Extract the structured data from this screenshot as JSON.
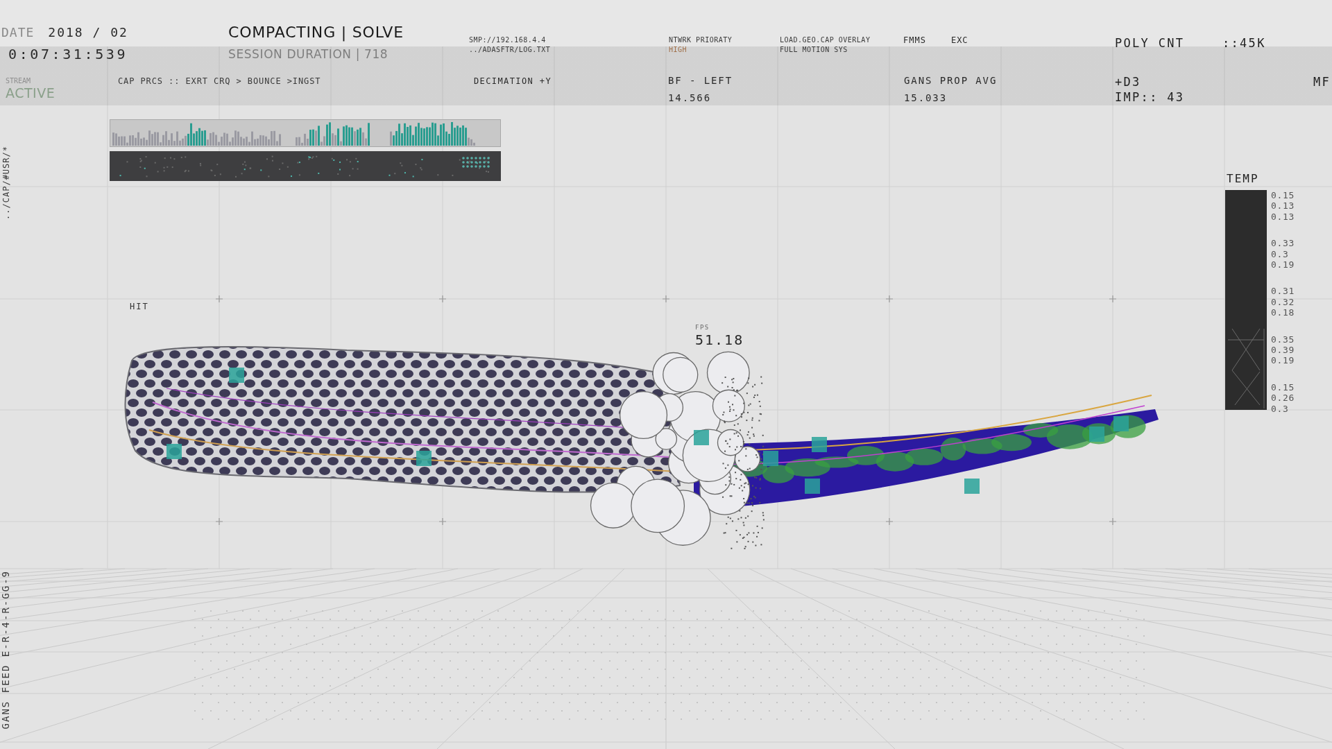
{
  "header": {
    "date_label": "DATE",
    "date": "2018 / 02",
    "clock": "0:07:31:539",
    "title": "COMPACTING | SOLVE",
    "session": "SESSION DURATION | 718",
    "stream_label": "STREAM",
    "stream_status": "ACTIVE",
    "pipeline": "CAP PRCS :: EXRT CRQ > BOUNCE >INGST",
    "path_lines": [
      "SMP://192.168.4.4",
      "../ADASFTR/LOG.TXT"
    ],
    "decimation": "DECIMATION +Y",
    "network": {
      "label": "NTWRK PRIORATY",
      "value": "HIGH"
    },
    "overlay_lines": [
      "LOAD.GEO.CAP OVERLAY",
      "FULL MOTION SYS"
    ],
    "flags": [
      "FMMS",
      "EXC"
    ],
    "bf": {
      "label": "BF - LEFT",
      "value": "14.566"
    },
    "gans": {
      "label": "GANS PROP AVG",
      "value": "15.033"
    },
    "poly": {
      "label": "POLY CNT",
      "value": "::45K"
    },
    "d3": "+D3",
    "imp": "IMP:: 43",
    "edge": "MF"
  },
  "side_labels": [
    "../CAP/#USR/*",
    "GANS FEED E-R-4-R-GG-9"
  ],
  "viewport": {
    "hit_label": "HIT",
    "fps_label": "FPS",
    "fps": "51.18"
  },
  "temp": {
    "label": "TEMP",
    "groups": [
      {
        "values": [
          "0.15",
          "0.13",
          "0.13"
        ]
      },
      {
        "values": [
          "0.33",
          "0.3",
          "0.19"
        ]
      },
      {
        "values": [
          "0.31",
          "0.32",
          "0.18"
        ]
      },
      {
        "values": [
          "0.35",
          "0.39",
          "0.19"
        ]
      },
      {
        "values": [
          "0.15",
          "0.26",
          "0.3"
        ]
      }
    ]
  }
}
